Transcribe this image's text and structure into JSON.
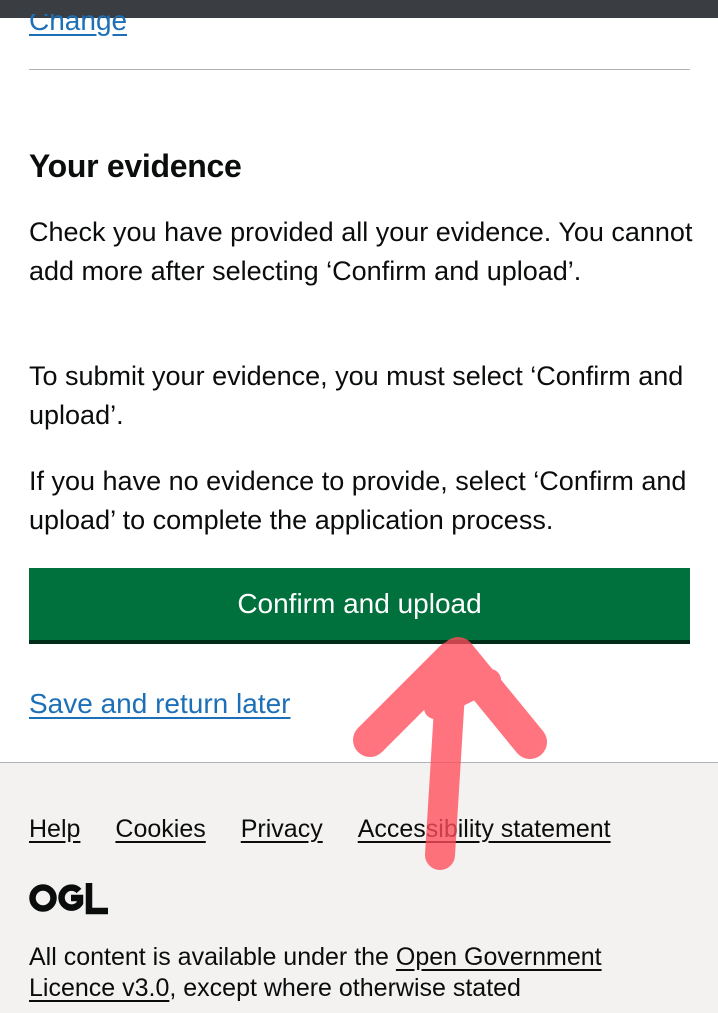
{
  "nav": {
    "change_link": "Change"
  },
  "section": {
    "heading": "Your evidence",
    "paragraphs": [
      "Check you have provided all your evidence. You cannot add more after selecting ‘Confirm and upload’.",
      "To submit your evidence, you must select ‘Confirm and upload’.",
      "If you have no evidence to provide, select ‘Confirm and upload’ to complete the application process."
    ],
    "confirm_button": "Confirm and upload",
    "save_link": "Save and return later"
  },
  "footer": {
    "links": [
      "Help",
      "Cookies",
      "Privacy",
      "Accessibility statement"
    ],
    "logo_text": "OGL",
    "licence_prefix": "All content is available under the ",
    "licence_link": "Open Government Licence v3.0",
    "licence_suffix": ", except where otherwise stated"
  },
  "colors": {
    "button_green": "#00703c",
    "link_blue": "#1d70b8",
    "footer_bg": "#f3f2f1",
    "annotation_arrow": "#ff4d5a"
  },
  "icons": {
    "annotation": "red-arrow-icon"
  }
}
